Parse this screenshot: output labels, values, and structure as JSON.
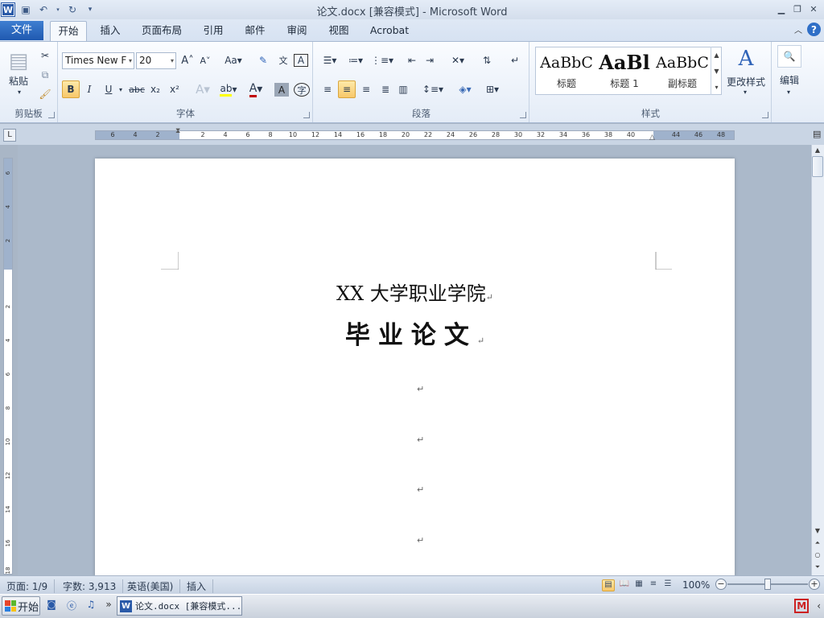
{
  "titlebar": {
    "title": "论文.docx [兼容模式] - Microsoft Word",
    "app_icon": "W"
  },
  "tabs": {
    "file": "文件",
    "home": "开始",
    "insert": "插入",
    "layout": "页面布局",
    "references": "引用",
    "mailings": "邮件",
    "review": "审阅",
    "view": "视图",
    "acrobat": "Acrobat"
  },
  "ribbon": {
    "clipboard": {
      "label": "剪贴板",
      "paste": "粘贴"
    },
    "font": {
      "label": "字体",
      "name": "Times New F",
      "size": "20"
    },
    "paragraph": {
      "label": "段落"
    },
    "styles": {
      "label": "样式",
      "items": [
        {
          "sample": "AaBbC",
          "name": "标题"
        },
        {
          "sample": "AaBl",
          "name": "标题 1"
        },
        {
          "sample": "AaBbC",
          "name": "副标题"
        }
      ],
      "change": "更改样式"
    },
    "editing": {
      "label": "编辑"
    }
  },
  "ruler": {
    "ticks": [
      "6",
      "4",
      "2",
      "2",
      "4",
      "6",
      "8",
      "10",
      "12",
      "14",
      "16",
      "18",
      "20",
      "22",
      "24",
      "26",
      "28",
      "30",
      "32",
      "34",
      "36",
      "38",
      "40",
      "44",
      "46",
      "48"
    ]
  },
  "vruler": {
    "ticks": [
      "6",
      "4",
      "2",
      "2",
      "4",
      "6",
      "8",
      "10",
      "12",
      "14",
      "16",
      "18"
    ]
  },
  "document": {
    "line1": "XX 大学职业学院",
    "line2": "毕业论文",
    "para_mark": "↵"
  },
  "statusbar": {
    "page": "页面: 1/9",
    "words": "字数: 3,913",
    "language": "英语(美国)",
    "mode": "插入",
    "zoom": "100%"
  },
  "taskbar": {
    "start": "开始",
    "task": "论文.docx [兼容模式..."
  },
  "colors": {
    "accent": "#2b579a",
    "file_tab": "#2a63b8",
    "font_color_bar": "#c00000",
    "highlight": "#ffff00"
  }
}
